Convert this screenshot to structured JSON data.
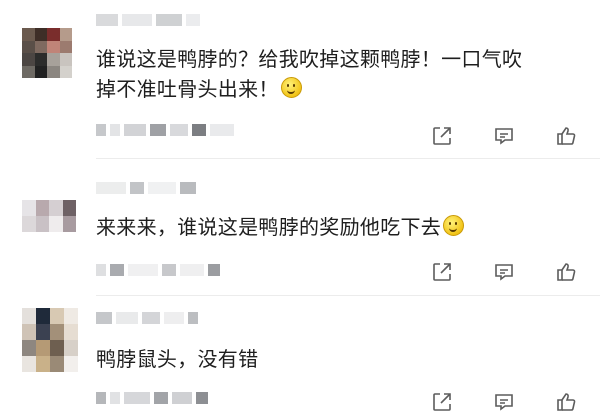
{
  "comments": [
    {
      "text_line1": "谁说这是鸭脖的？给我吹掉这颗鸭脖！一口气吹",
      "text_line2": "掉不准吐骨头出来！"
    },
    {
      "text_line1": "来来来，谁说这是鸭脖的奖励他吃下去"
    },
    {
      "text_line1": "鸭脖鼠头，没有错"
    }
  ],
  "icons": {
    "share": "share-icon",
    "comment": "comment-icon",
    "like": "thumbs-up-icon",
    "emoji": "smile-emoji-icon"
  }
}
